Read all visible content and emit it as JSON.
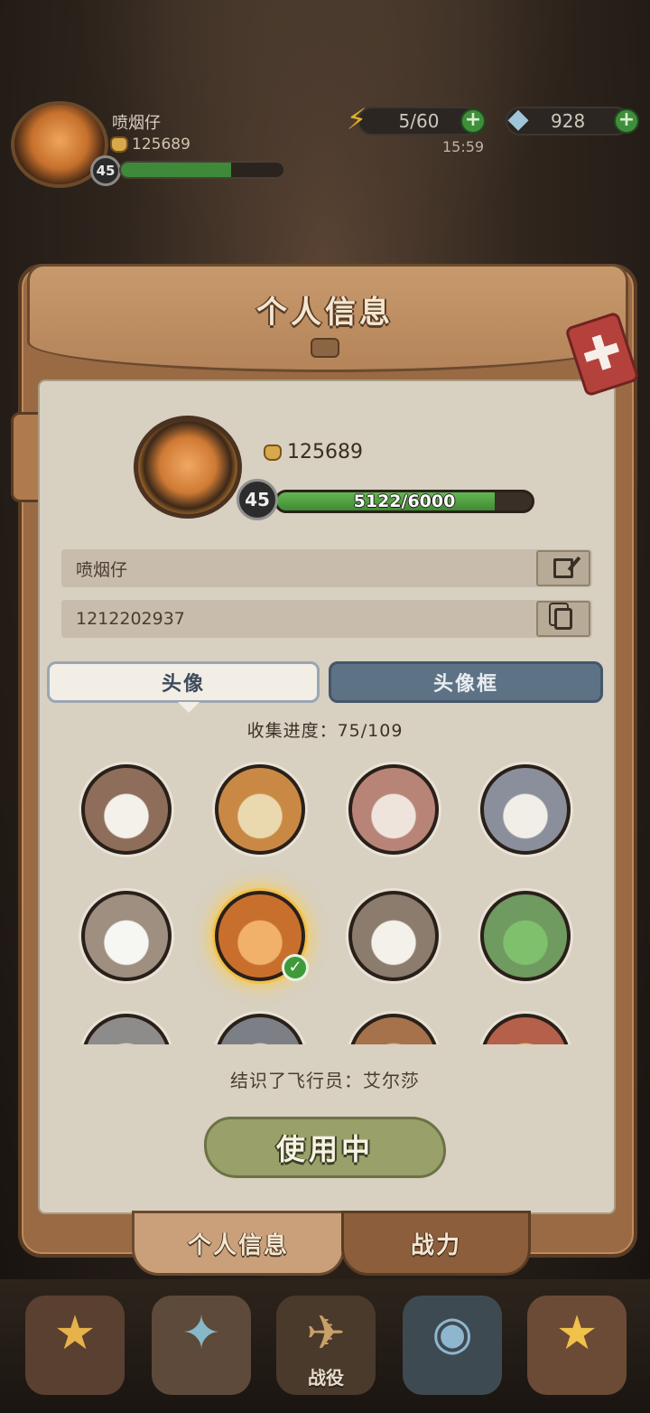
{
  "hud": {
    "name": "喷烟仔",
    "power": "125689",
    "level": "45",
    "xp_fraction": 0.68,
    "energy": "5/60",
    "energy_timer": "15:59",
    "gems": "928",
    "plus": "+"
  },
  "panel": {
    "title": "个人信息",
    "close": "✚"
  },
  "profile": {
    "power": "125689",
    "level": "45",
    "xp_text": "5122/6000",
    "xp_fraction": 0.8537,
    "name": "喷烟仔",
    "id": "1212202937"
  },
  "tabs": {
    "avatar": "头像",
    "frame": "头像框"
  },
  "collection": {
    "progress": "收集进度：75/109"
  },
  "avatars": [
    {
      "name": "bear-pilot",
      "bg": "#8e6e5a",
      "face": "#f3f1ea"
    },
    {
      "name": "fox-goggles",
      "bg": "#c98944",
      "face": "#ead9ae"
    },
    {
      "name": "cat-pink-hair",
      "bg": "#b88478",
      "face": "#efe4dc"
    },
    {
      "name": "dog-blue-cap",
      "bg": "#8a8f9b",
      "face": "#f1eee7"
    },
    {
      "name": "duck-sailor",
      "bg": "#9f8f80",
      "face": "#f6f6f2"
    },
    {
      "name": "fox-hat-selected",
      "bg": "#c96f2d",
      "face": "#f2b16a",
      "selected": true
    },
    {
      "name": "sheep-pilot",
      "bg": "#8c7c6e",
      "face": "#f4f1ea"
    },
    {
      "name": "frog-red-cap",
      "bg": "#6f9a60",
      "face": "#7fc06d"
    },
    {
      "name": "mouse-grey",
      "bg": "#8e8c8a",
      "face": "#d7d3ce"
    },
    {
      "name": "rabbit-grey",
      "bg": "#7c7f86",
      "face": "#cfd0d4"
    },
    {
      "name": "deer-brown",
      "bg": "#a5724b",
      "face": "#dcb37e"
    },
    {
      "name": "king-crown",
      "bg": "#b4604b",
      "face": "#eec05a"
    }
  ],
  "selected": {
    "description": "结识了飞行员：艾尔莎",
    "button": "使用中",
    "check": "✓"
  },
  "bottom_tabs": {
    "info": "个人信息",
    "power": "战力"
  },
  "nav": {
    "campaign": "战役"
  }
}
